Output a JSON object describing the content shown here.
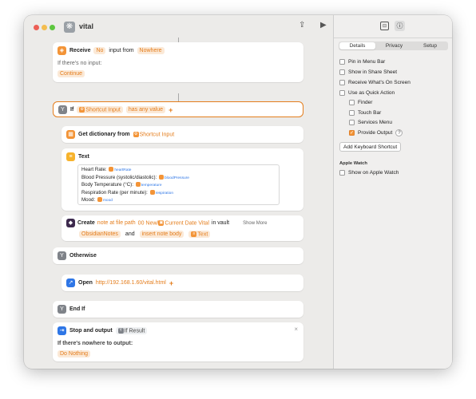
{
  "window": {
    "title": "vital"
  },
  "actions": {
    "receive": {
      "label": "Receive",
      "input_type": "No",
      "input_from_label": "input from",
      "source": "Nowhere",
      "no_input_label": "If there's no input:",
      "no_input_action": "Continue"
    },
    "if": {
      "label": "If",
      "variable": "Shortcut Input",
      "condition": "has any value",
      "add": "+"
    },
    "get_dict": {
      "label": "Get dictionary from",
      "variable": "Shortcut Input"
    },
    "text": {
      "label": "Text",
      "lines": [
        {
          "label": "Heart Rate:",
          "var": "heartRate"
        },
        {
          "label": "Blood Pressure (systolic/diastolic):",
          "var": "bloodPressure"
        },
        {
          "label": "Body Temperature (°C):",
          "var": "temperature"
        },
        {
          "label": "Respiration Rate (per minute):",
          "var": "respiration"
        },
        {
          "label": "Mood:",
          "var": "mood"
        }
      ]
    },
    "create": {
      "label": "Create",
      "type": "note at file path",
      "path_prefix": "00 New/",
      "path_var": "Current Date",
      "path_suffix": "Vital",
      "in_vault": "in vault",
      "vault": "ObsidianNotes",
      "and": "and",
      "op": "insert note body",
      "body_var": "Text",
      "show_more": "Show More"
    },
    "otherwise": {
      "label": "Otherwise"
    },
    "open": {
      "label": "Open",
      "url": "http://192.168.1.60/vital.html",
      "add": "+"
    },
    "end_if": {
      "label": "End If"
    },
    "stop": {
      "label": "Stop and output",
      "variable": "If Result",
      "close": "×",
      "nowhere_label": "If there's nowhere to output:",
      "nowhere_action": "Do Nothing"
    }
  },
  "sidebar": {
    "tabs": [
      "Details",
      "Privacy",
      "Setup"
    ],
    "active_tab": "Details",
    "options": [
      {
        "label": "Pin in Menu Bar",
        "checked": false
      },
      {
        "label": "Show in Share Sheet",
        "checked": false
      },
      {
        "label": "Receive What's On Screen",
        "checked": false
      },
      {
        "label": "Use as Quick Action",
        "checked": false
      },
      {
        "label": "Finder",
        "checked": false
      },
      {
        "label": "Touch Bar",
        "checked": false
      },
      {
        "label": "Services Menu",
        "checked": false
      },
      {
        "label": "Provide Output",
        "checked": true
      }
    ],
    "help": "?",
    "shortcut_button": "Add Keyboard Shortcut",
    "apple_watch_header": "Apple Watch",
    "apple_watch_option": {
      "label": "Show on Apple Watch",
      "checked": false
    }
  },
  "colors": {
    "accent": "#f39437",
    "variable_orange": "#e47d1c",
    "magic_var_blue": "#2e76e6"
  }
}
